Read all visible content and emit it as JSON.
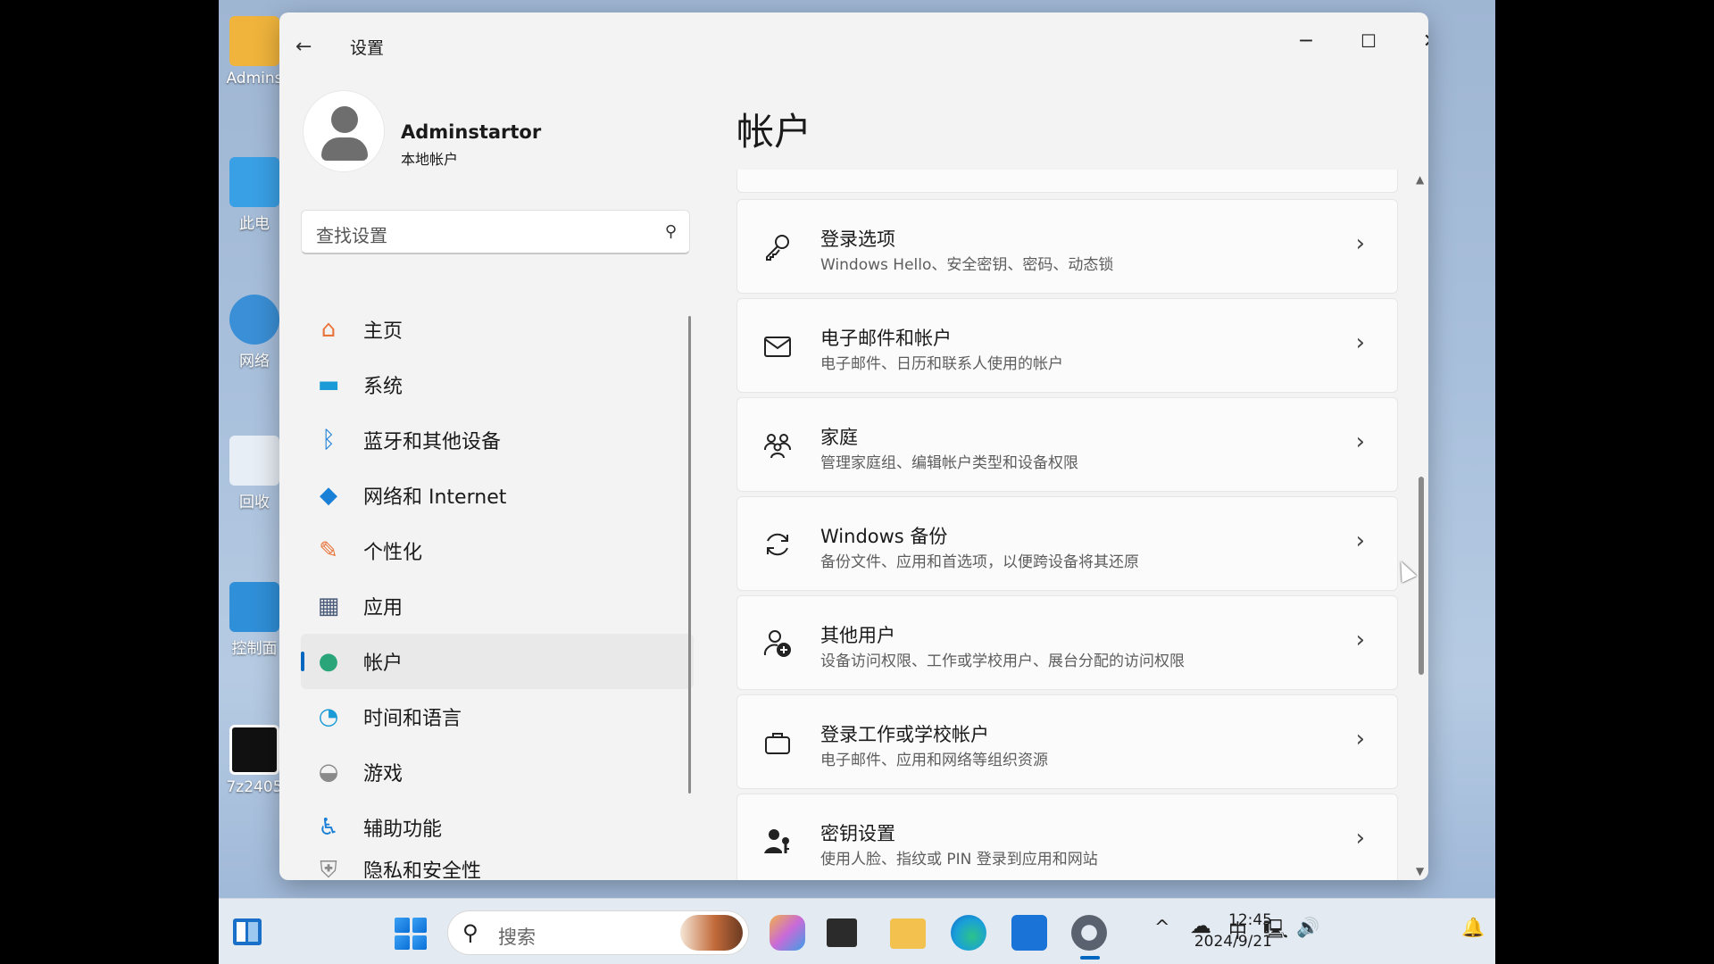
{
  "desktop": {
    "icons": [
      {
        "label": "Admins",
        "icon": "user-folder-icon",
        "color": "#f0b43c"
      },
      {
        "label": "此电",
        "icon": "this-pc-icon",
        "color": "#3aa0e6"
      },
      {
        "label": "网络",
        "icon": "network-icon",
        "color": "#3a8fd6"
      },
      {
        "label": "回收",
        "icon": "recycle-bin-icon",
        "color": "#e8eef5"
      },
      {
        "label": "控制面",
        "icon": "control-panel-icon",
        "color": "#2f8fd8"
      },
      {
        "label": "7z2405",
        "icon": "7zip-icon",
        "color": "#111111"
      }
    ]
  },
  "window": {
    "title": "设置",
    "back_icon": "back-arrow-icon",
    "caption": {
      "minimize": "─",
      "maximize": "☐",
      "close": "✕"
    }
  },
  "profile": {
    "name": "Adminstartor",
    "account_type": "本地帐户"
  },
  "search": {
    "placeholder": "查找设置",
    "icon": "search-icon"
  },
  "nav": {
    "items": [
      {
        "label": "主页",
        "icon": "home-icon",
        "glyph": "⌂",
        "color": "#e8743b"
      },
      {
        "label": "系统",
        "icon": "system-icon",
        "glyph": "▬",
        "color": "#1a9ad6"
      },
      {
        "label": "蓝牙和其他设备",
        "icon": "bluetooth-icon",
        "glyph": "ᛒ",
        "color": "#1a7fd6"
      },
      {
        "label": "网络和 Internet",
        "icon": "wifi-icon",
        "glyph": "◆",
        "color": "#1a7fd6"
      },
      {
        "label": "个性化",
        "icon": "brush-icon",
        "glyph": "✎",
        "color": "#e8743b"
      },
      {
        "label": "应用",
        "icon": "apps-icon",
        "glyph": "▦",
        "color": "#4a5a78"
      },
      {
        "label": "帐户",
        "icon": "account-icon",
        "glyph": "●",
        "color": "#2aa57a",
        "active": true
      },
      {
        "label": "时间和语言",
        "icon": "time-language-icon",
        "glyph": "◔",
        "color": "#1a9ad6"
      },
      {
        "label": "游戏",
        "icon": "gamepad-icon",
        "glyph": "◒",
        "color": "#8a8a8a"
      },
      {
        "label": "辅助功能",
        "icon": "accessibility-icon",
        "glyph": "♿",
        "color": "#1a7fd6"
      },
      {
        "label": "隐私和安全性",
        "icon": "privacy-icon",
        "glyph": "⛨",
        "color": "#8a8a8a"
      }
    ]
  },
  "main": {
    "title": "帐户",
    "cards": [
      {
        "title": "登录选项",
        "desc": "Windows Hello、安全密钥、密码、动态锁",
        "icon": "key-icon",
        "glyph": "⚷"
      },
      {
        "title": "电子邮件和帐户",
        "desc": "电子邮件、日历和联系人使用的帐户",
        "icon": "mail-icon",
        "glyph": "✉"
      },
      {
        "title": "家庭",
        "desc": "管理家庭组、编辑帐户类型和设备权限",
        "icon": "family-icon",
        "glyph": "♡"
      },
      {
        "title": "Windows 备份",
        "desc": "备份文件、应用和首选项，以便跨设备将其还原",
        "icon": "sync-icon",
        "glyph": "⟳"
      },
      {
        "title": "其他用户",
        "desc": "设备访问权限、工作或学校用户、展台分配的访问权限",
        "icon": "add-user-icon",
        "glyph": "⊕"
      },
      {
        "title": "登录工作或学校帐户",
        "desc": "电子邮件、应用和网络等组织资源",
        "icon": "briefcase-icon",
        "glyph": "▭"
      },
      {
        "title": "密钥设置",
        "desc": "使用人脸、指纹或 PIN 登录到应用和网站",
        "icon": "passkey-icon",
        "glyph": "⚿"
      }
    ],
    "chevron": "›"
  },
  "taskbar": {
    "search_label": "搜索",
    "apps": [
      {
        "name": "copilot-icon",
        "color": "#c86ad8"
      },
      {
        "name": "file-explorer-dark-icon",
        "color": "#2b2b2b"
      },
      {
        "name": "folder-icon",
        "color": "#f2c14e"
      },
      {
        "name": "edge-icon",
        "color": "#1aa0d8"
      },
      {
        "name": "store-icon",
        "color": "#1a73d6"
      },
      {
        "name": "settings-icon",
        "color": "#5a6270"
      }
    ],
    "tray": {
      "chevron": "^",
      "onedrive": "☁",
      "ime": "中",
      "network": "🖳",
      "volume": "🔊"
    },
    "time": "12:45",
    "date": "2024/9/21"
  }
}
